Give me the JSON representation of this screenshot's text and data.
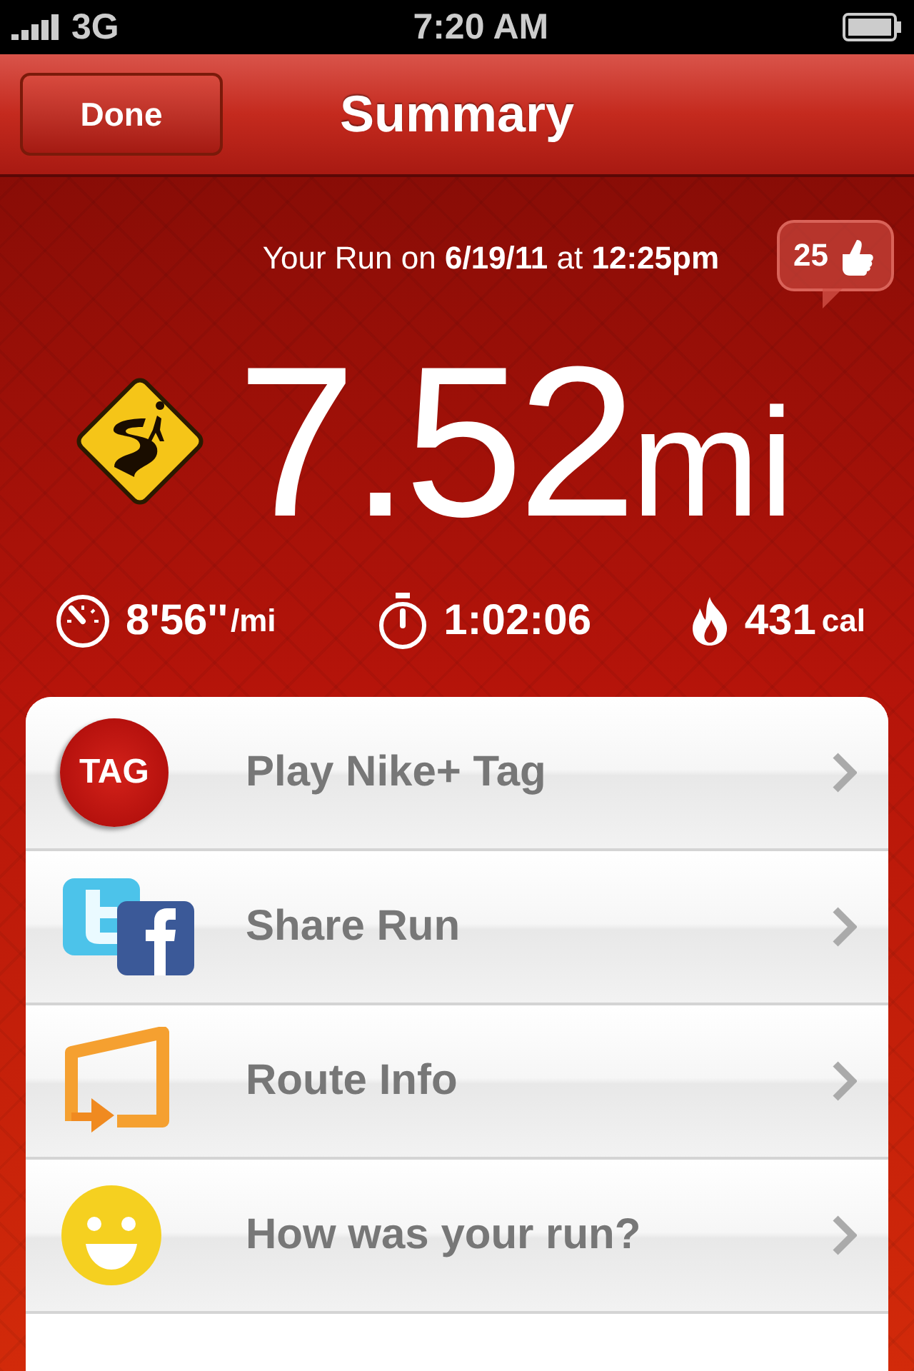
{
  "status_bar": {
    "carrier": "3G",
    "time": "7:20 AM"
  },
  "nav": {
    "back_button": "Done",
    "title": "Summary"
  },
  "run": {
    "caption": "Your Run on **6/19/11** at **12:25pm**",
    "likes": "25",
    "distance": "7.52",
    "unit": "mi"
  },
  "stats": [
    {
      "kind": "pace",
      "value": "8'56''",
      "unit": "/mi"
    },
    {
      "kind": "time",
      "value": "1:02:06"
    },
    {
      "kind": "calories",
      "value": "431",
      "unit": "cal"
    }
  ],
  "menu": [
    {
      "kind": "tag",
      "label": "Play Nike+ Tag",
      "badge": "TAG"
    },
    {
      "kind": "share",
      "label": "Share Run"
    },
    {
      "kind": "route",
      "label": "Route Info"
    },
    {
      "kind": "mood",
      "label": "How was your run?"
    }
  ]
}
